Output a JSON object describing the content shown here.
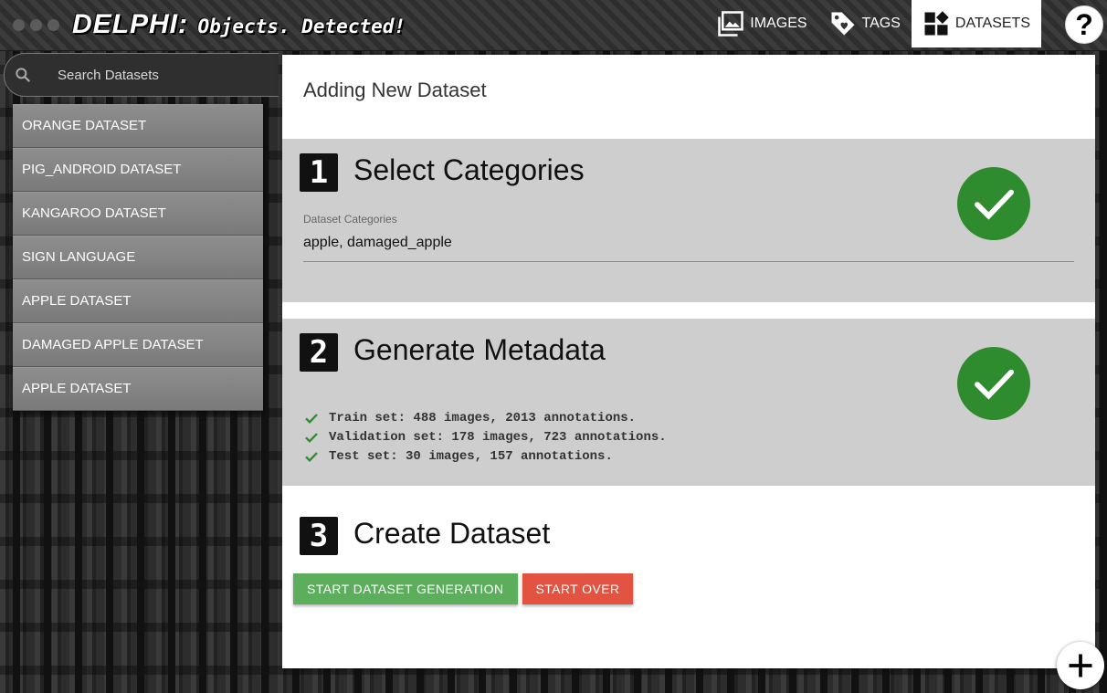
{
  "brand": {
    "name": "DELPHI:",
    "tagline": "Objects. Detected!"
  },
  "nav": [
    {
      "label": "IMAGES",
      "icon": "images-icon"
    },
    {
      "label": "TAGS",
      "icon": "tags-icon"
    },
    {
      "label": "DATASETS",
      "icon": "datasets-icon",
      "active": true
    }
  ],
  "help": {
    "label": "?"
  },
  "search": {
    "placeholder": "Search Datasets",
    "value": ""
  },
  "datasets": [
    "ORANGE DATASET",
    "PIG_ANDROID DATASET",
    "KANGAROO DATASET",
    "SIGN LANGUAGE",
    "APPLE DATASET",
    "DAMAGED APPLE DATASET",
    "APPLE DATASET"
  ],
  "panel": {
    "title": "Adding New Dataset"
  },
  "steps": [
    {
      "number": "1",
      "title": "Select Categories",
      "complete": true,
      "field_label": "Dataset Categories",
      "field_value": "apple, damaged_apple"
    },
    {
      "number": "2",
      "title": "Generate Metadata",
      "complete": true,
      "items": [
        "Train set: 488 images, 2013 annotations.",
        "Validation set: 178 images, 723 annotations.",
        "Test set: 30 images, 157 annotations."
      ]
    },
    {
      "number": "3",
      "title": "Create Dataset",
      "start_label": "START DATASET GENERATION",
      "reset_label": "START OVER"
    }
  ],
  "fab": {
    "label": "+"
  },
  "colors": {
    "success": "#2e8b2e",
    "primary_button": "#5cae5c",
    "danger_button": "#e35342",
    "step_background": "#cecece"
  }
}
